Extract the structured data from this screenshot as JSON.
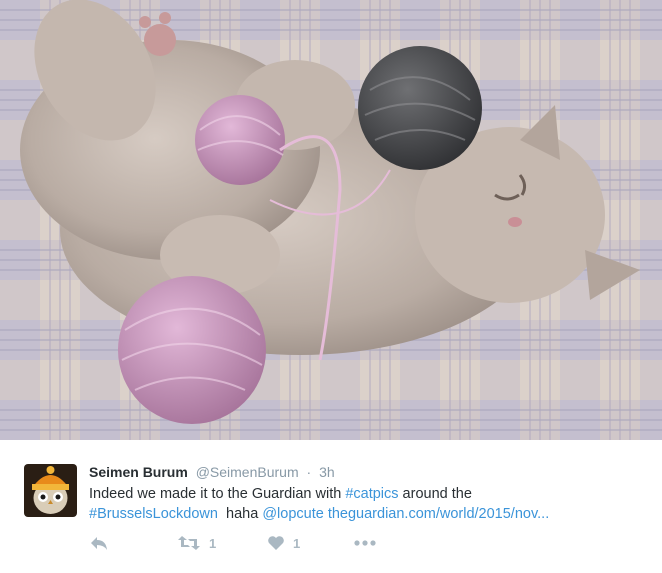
{
  "media": {
    "icon": "kitten-photo"
  },
  "tweet": {
    "avatar_icon": "owl-with-knit-hat-avatar",
    "fullname": "Seimen Burum",
    "username": "@SeimenBurum",
    "separator": "·",
    "time": "3h",
    "text_line1_prefix": "Indeed we made it to the Guardian with ",
    "hashtag1": "#catpics",
    "text_line1_suffix": " around the",
    "hashtag2": "#BrusselsLockdown",
    "text_mid": "  haha ",
    "mention": "@lopcute",
    "text_space": " ",
    "url": "theguardian.com/world/2015/nov..."
  },
  "actions": {
    "reply": {
      "icon": "reply-icon"
    },
    "retweet": {
      "icon": "retweet-icon",
      "count": "1"
    },
    "like": {
      "icon": "heart-icon",
      "count": "1"
    },
    "more": {
      "icon": "more-dots-icon"
    }
  },
  "colors": {
    "link": "#3b94d9",
    "muted": "#8899a6",
    "action": "#aab8c2",
    "text": "#292f33"
  }
}
